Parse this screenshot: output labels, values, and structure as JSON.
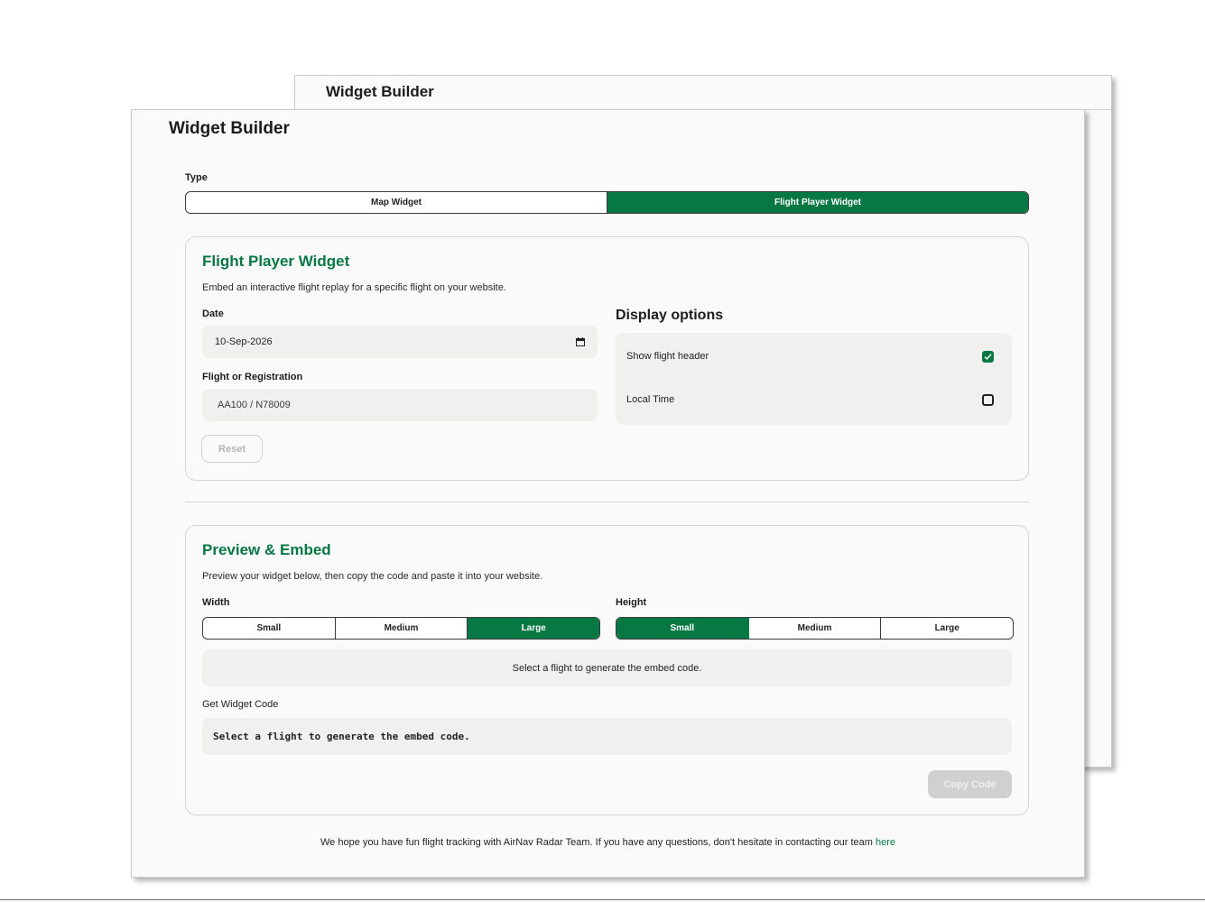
{
  "back_window": {
    "title": "Widget Builder"
  },
  "window": {
    "title": "Widget Builder"
  },
  "type_selector": {
    "label": "Type",
    "options": [
      {
        "label": "Map Widget",
        "active": false
      },
      {
        "label": "Flight Player Widget",
        "active": true
      }
    ]
  },
  "config_panel": {
    "title": "Flight Player Widget",
    "description": "Embed an interactive flight replay for a specific flight on your website.",
    "date": {
      "label": "Date",
      "value": "10-Sep-2026",
      "icon": "calendar-icon"
    },
    "flight": {
      "label": "Flight or Registration",
      "placeholder": "AA100 / N78009"
    },
    "reset_label": "Reset",
    "display_options": {
      "title": "Display options",
      "items": [
        {
          "label": "Show flight header",
          "checked": true
        },
        {
          "label": "Local Time",
          "checked": false
        }
      ]
    }
  },
  "preview_panel": {
    "title": "Preview & Embed",
    "description": "Preview your widget below, then copy the code and paste it into your website.",
    "width": {
      "label": "Width",
      "options": [
        {
          "label": "Small",
          "active": false
        },
        {
          "label": "Medium",
          "active": false
        },
        {
          "label": "Large",
          "active": true
        }
      ]
    },
    "height": {
      "label": "Height",
      "options": [
        {
          "label": "Small",
          "active": true
        },
        {
          "label": "Medium",
          "active": false
        },
        {
          "label": "Large",
          "active": false
        }
      ]
    },
    "preview_message": "Select a flight to generate the embed code.",
    "code_label": "Get Widget Code",
    "code_value": "Select a flight to generate the embed code.",
    "copy_label": "Copy Code"
  },
  "footer": {
    "text": "We hope you have fun flight tracking with AirNav Radar Team. If you have any questions, don't hesitate in contacting our team ",
    "link_label": "here"
  },
  "colors": {
    "accent": "#077844",
    "panel_bg": "#f0f1ef"
  }
}
